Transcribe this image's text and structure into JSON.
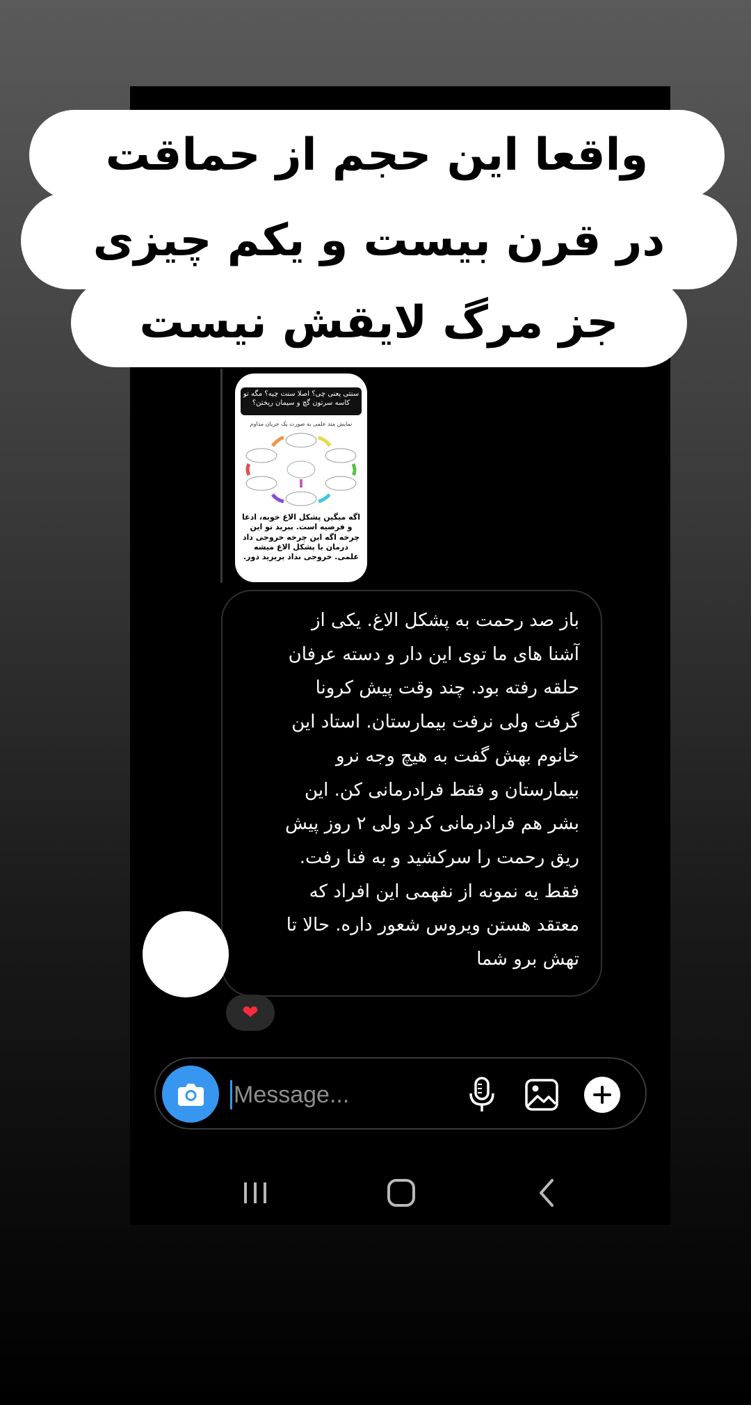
{
  "overlay_caption": {
    "line1": "واقعا این حجم از حماقت",
    "line2": "در قرن بیست و یکم چیزی",
    "line3": "جز مرگ لایقش نیست"
  },
  "shared_post": {
    "header": "سنتی یعنی چی؟ اصلا سنت چیه؟ مگه تو کاسه سرتون گچ و سیمان ریختن؟",
    "subtitle": "نمایش متد علمی به صورت یک جریان مداوم",
    "footer": "اگه میگین پشکل الاغ خوبه، ادعا و فرضیه است. ببرید تو این چرخه اگه این چرخه خروجی داد درمان با پشکل الاغ میشه علمی. خروجی نداد بریزید دور."
  },
  "message": {
    "lines": [
      "باز صد رحمت به پشکل الاغ. یکی از",
      "آشنا های ما توی این دار و دسته عرفان",
      "حلقه رفته بود. چند وقت پیش کرونا",
      "گرفت ولی نرفت بیمارستان. استاد این",
      "خانوم بهش گفت به هیچ  وجه نرو",
      "بیمارستان و فقط فرادرمانی کن. این",
      "بشر هم فرادرمانی کرد ولی ۲ روز پیش",
      "ریق رحمت را سرکشید و به فنا رفت.",
      "فقط یه نمونه از نفهمی این افراد که",
      "معتقد هستن ویروس شعور داره. حالا تا",
      "تهش برو شما"
    ],
    "reaction": "❤"
  },
  "composer": {
    "placeholder": "Message..."
  },
  "icons": {
    "camera": "camera-icon",
    "mic": "microphone-icon",
    "gallery": "gallery-icon",
    "plus": "plus-icon",
    "nav_recent": "recent-apps-icon",
    "nav_home": "home-icon",
    "nav_back": "back-icon"
  },
  "colors": {
    "accent": "#3797f0",
    "reaction_heart": "#ff2a3d"
  }
}
